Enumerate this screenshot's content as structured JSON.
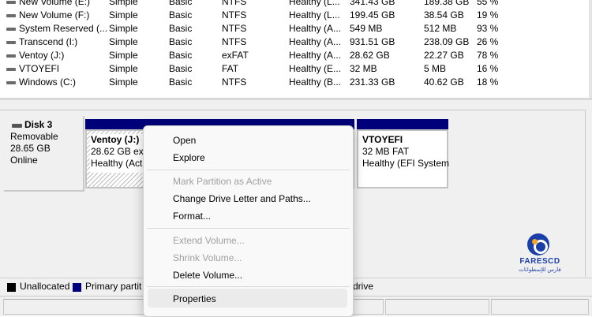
{
  "volumes": [
    {
      "name": "New Volume (E:)",
      "layout": "Simple",
      "type": "Basic",
      "fs": "NTFS",
      "status": "Healthy (L...",
      "capacity": "341.43 GB",
      "free": "189.38 GB",
      "pct": "55 %"
    },
    {
      "name": "New Volume (F:)",
      "layout": "Simple",
      "type": "Basic",
      "fs": "NTFS",
      "status": "Healthy (L...",
      "capacity": "199.45 GB",
      "free": "38.54 GB",
      "pct": "19 %"
    },
    {
      "name": "System Reserved (...",
      "layout": "Simple",
      "type": "Basic",
      "fs": "NTFS",
      "status": "Healthy (A...",
      "capacity": "549 MB",
      "free": "512 MB",
      "pct": "93 %"
    },
    {
      "name": "Transcend (I:)",
      "layout": "Simple",
      "type": "Basic",
      "fs": "NTFS",
      "status": "Healthy (A...",
      "capacity": "931.51 GB",
      "free": "238.09 GB",
      "pct": "26 %"
    },
    {
      "name": "Ventoy (J:)",
      "layout": "Simple",
      "type": "Basic",
      "fs": "exFAT",
      "status": "Healthy (A...",
      "capacity": "28.62 GB",
      "free": "22.27 GB",
      "pct": "78 %"
    },
    {
      "name": "VTOYEFI",
      "layout": "Simple",
      "type": "Basic",
      "fs": "FAT",
      "status": "Healthy (E...",
      "capacity": "32 MB",
      "free": "5 MB",
      "pct": "16 %"
    },
    {
      "name": "Windows (C:)",
      "layout": "Simple",
      "type": "Basic",
      "fs": "NTFS",
      "status": "Healthy (B...",
      "capacity": "231.33 GB",
      "free": "40.62 GB",
      "pct": "18 %"
    }
  ],
  "disk3": {
    "title": "Disk 3",
    "kind": "Removable",
    "size": "28.65 GB",
    "state": "Online"
  },
  "partitions": {
    "ventoy": {
      "name": "Ventoy  (J:)",
      "size": "28.62 GB exF",
      "health": "Healthy (Act"
    },
    "efi": {
      "name": "VTOYEFI",
      "size": "32 MB FAT",
      "health": "Healthy (EFI System"
    }
  },
  "legend": {
    "unallocated": "Unallocated",
    "primary": "Primary partit",
    "logical": "l drive",
    "colors": {
      "unallocated": "#000000",
      "primary": "#00007a"
    }
  },
  "menu": {
    "open": "Open",
    "explore": "Explore",
    "mark_active": "Mark Partition as Active",
    "change_letter": "Change Drive Letter and Paths...",
    "format": "Format...",
    "extend": "Extend Volume...",
    "shrink": "Shrink Volume...",
    "delete": "Delete Volume...",
    "properties": "Properties"
  },
  "logo": {
    "name": "FARESCD",
    "subtitle": "فارس للإسطوانات",
    "colors": {
      "primary": "#1b3fa8",
      "accent": "#f5a623"
    }
  }
}
